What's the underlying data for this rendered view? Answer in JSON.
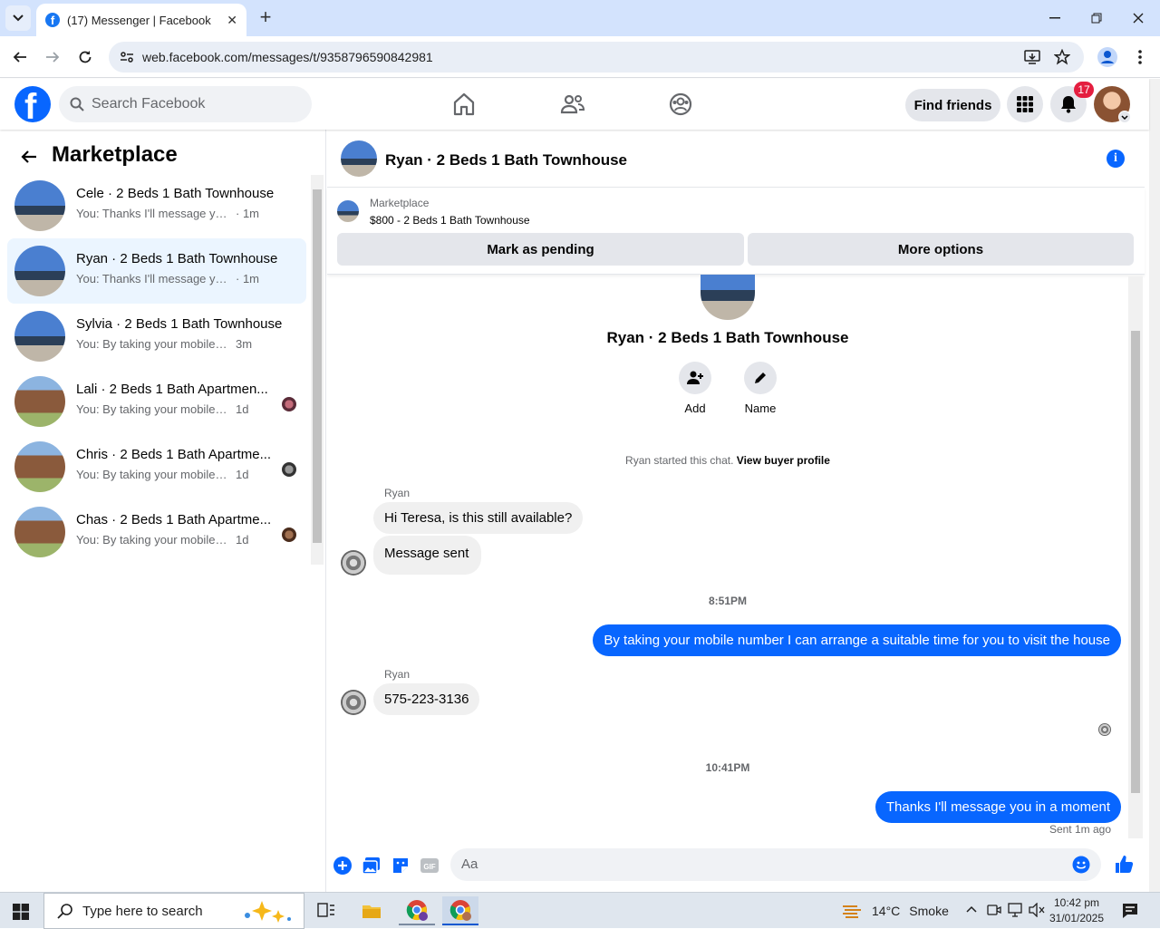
{
  "browser": {
    "tab_title": "(17) Messenger | Facebook",
    "url": "web.facebook.com/messages/t/9358796590842981"
  },
  "fb": {
    "search_placeholder": "Search Facebook",
    "find_friends": "Find friends",
    "notif_count": "17",
    "brand_color": "#0866ff"
  },
  "sidebar": {
    "title": "Marketplace",
    "conversations": [
      {
        "name": "Cele · 2 Beds 1 Bath Townhouse",
        "snippet": "You: Thanks I'll message you in a ...",
        "time": "· 1m",
        "thumb": "townhouse"
      },
      {
        "name": "Ryan · 2 Beds 1 Bath Townhouse",
        "snippet": "You: Thanks I'll message you in a ...",
        "time": "· 1m",
        "thumb": "townhouse",
        "active": true
      },
      {
        "name": "Sylvia · 2 Beds 1 Bath Townhouse",
        "snippet": "You: By taking your mobile numbe...",
        "time": "3m",
        "thumb": "townhouse"
      },
      {
        "name": "Lali · 2 Beds 1 Bath Apartmen...",
        "snippet": "You: By taking your mobile num...",
        "time": "1d",
        "thumb": "apartment"
      },
      {
        "name": "Chris · 2 Beds 1 Bath Apartme...",
        "snippet": "You: By taking your mobile num...",
        "time": "1d",
        "thumb": "apartment"
      },
      {
        "name": "Chas · 2 Beds 1 Bath Apartme...",
        "snippet": "You: By taking your mobile num...",
        "time": "1d",
        "thumb": "apartment"
      }
    ]
  },
  "chat": {
    "title": "Ryan · 2 Beds 1 Bath Townhouse",
    "listing_label": "Marketplace",
    "listing_price": "$800 - 2 Beds 1 Bath Townhouse",
    "mark_pending": "Mark as pending",
    "more_options": "More options",
    "intro_title": "Ryan · 2 Beds 1 Bath Townhouse",
    "add_label": "Add",
    "name_label": "Name",
    "started_text": "Ryan started this chat.",
    "view_profile": "View buyer profile",
    "sender1": "Ryan",
    "msg1": "Hi Teresa, is this still available?",
    "msg2": "Message sent",
    "time1": "8:51PM",
    "msg3": "By taking your mobile number I can arrange a suitable time for you to visit the house",
    "sender2": "Ryan",
    "msg4": "575-223-3136",
    "time2": "10:41PM",
    "msg5": "Thanks I'll message you in a moment",
    "sent_status": "Sent 1m ago",
    "input_placeholder": "Aa"
  },
  "taskbar": {
    "search_placeholder": "Type here to search",
    "temp": "14°C",
    "weather": "Smoke",
    "time": "10:42 pm",
    "date": "31/01/2025"
  }
}
